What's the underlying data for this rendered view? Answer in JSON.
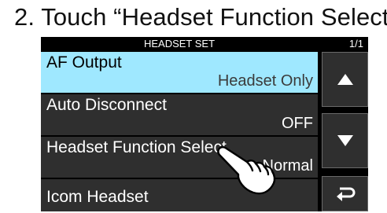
{
  "instruction": {
    "step": "2.",
    "text": "Touch “Headset Function Select.”"
  },
  "screen": {
    "title": "HEADSET SET",
    "page_indicator": "1/1",
    "items": [
      {
        "label": "AF Output",
        "value": "Headset Only",
        "selected": true
      },
      {
        "label": "Auto Disconnect",
        "value": "OFF",
        "selected": false
      },
      {
        "label": "Headset Function Select",
        "value": "Normal",
        "selected": false
      },
      {
        "label": "Icom Headset",
        "value": "",
        "selected": false
      }
    ],
    "buttons": {
      "up": "up-arrow-icon",
      "down": "down-arrow-icon",
      "back": "return-icon"
    }
  },
  "overlay": {
    "icon": "touch-hand-icon"
  },
  "colors": {
    "screen_bg": "#000000",
    "item_bg": "#2f2f2f",
    "selected_bg": "#9fe8ff"
  }
}
